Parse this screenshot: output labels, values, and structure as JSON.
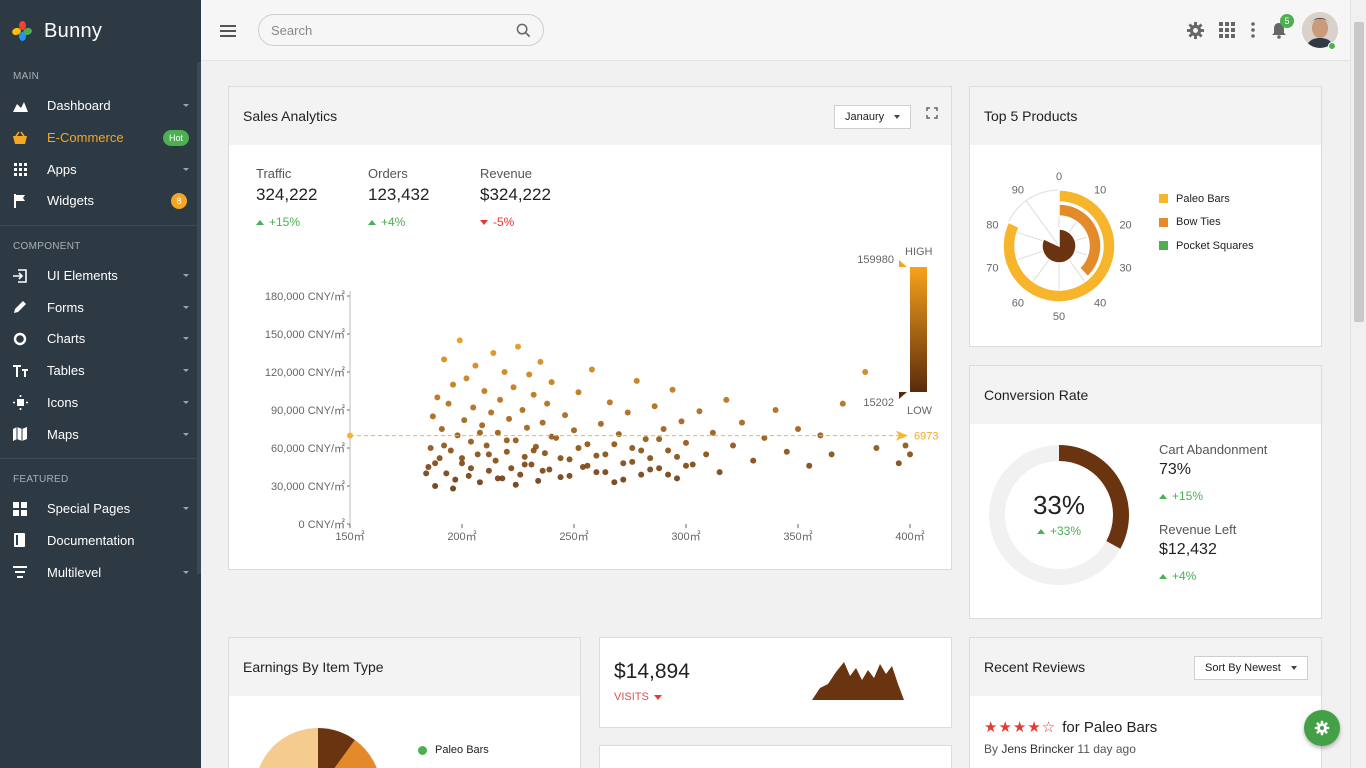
{
  "app": {
    "name": "Bunny"
  },
  "sidebar": {
    "sections": [
      {
        "label": "MAIN",
        "items": [
          {
            "label": "Dashboard",
            "icon": "area-chart-icon",
            "caret": true
          },
          {
            "label": "E-Commerce",
            "icon": "basket-icon",
            "badge": "Hot",
            "active": true
          },
          {
            "label": "Apps",
            "icon": "grid-icon",
            "caret": true
          },
          {
            "label": "Widgets",
            "icon": "flag-icon",
            "count": "8"
          }
        ]
      },
      {
        "label": "COMPONENT",
        "items": [
          {
            "label": "UI Elements",
            "icon": "login-icon",
            "caret": true
          },
          {
            "label": "Forms",
            "icon": "pencil-icon",
            "caret": true
          },
          {
            "label": "Charts",
            "icon": "donut-icon",
            "caret": true
          },
          {
            "label": "Tables",
            "icon": "text-height-icon",
            "caret": true
          },
          {
            "label": "Icons",
            "icon": "sun-icon",
            "caret": true
          },
          {
            "label": "Maps",
            "icon": "map-icon",
            "caret": true
          }
        ]
      },
      {
        "label": "FEATURED",
        "items": [
          {
            "label": "Special Pages",
            "icon": "pages-icon",
            "caret": true
          },
          {
            "label": "Documentation",
            "icon": "book-icon"
          },
          {
            "label": "Multilevel",
            "icon": "filter-icon",
            "caret": true
          }
        ]
      }
    ]
  },
  "topbar": {
    "search_placeholder": "Search",
    "notification_count": "5"
  },
  "sales": {
    "title": "Sales Analytics",
    "month": "Janaury",
    "stats": [
      {
        "label": "Traffic",
        "value": "324,222",
        "change": "+15%",
        "dir": "up"
      },
      {
        "label": "Orders",
        "value": "123,432",
        "change": "+4%",
        "dir": "up"
      },
      {
        "label": "Revenue",
        "value": "$324,222",
        "change": "-5%",
        "dir": "down"
      }
    ]
  },
  "top_products": {
    "title": "Top 5 Products",
    "legend": [
      {
        "name": "Paleo Bars",
        "color": "#f7b52c"
      },
      {
        "name": "Bow Ties",
        "color": "#e58a2a"
      },
      {
        "name": "Pocket Squares",
        "color": "#4caf50"
      }
    ],
    "ticks": [
      "0",
      "10",
      "20",
      "30",
      "40",
      "50",
      "60",
      "70",
      "80",
      "90"
    ]
  },
  "conversion": {
    "title": "Conversion Rate",
    "value": "33%",
    "change": "+33%",
    "percent": 33,
    "items": [
      {
        "label": "Cart Abandonment",
        "value": "73%",
        "change": "+15%"
      },
      {
        "label": "Revenue Left",
        "value": "$12,432",
        "change": "+4%"
      }
    ]
  },
  "earnings": {
    "title": "Earnings By Item Type",
    "legend": [
      "Paleo Bars"
    ]
  },
  "visits": {
    "value": "$14,894",
    "label": "VISITS"
  },
  "reviews": {
    "title": "Recent Reviews",
    "sort": "Sort By Newest",
    "items": [
      {
        "rating": 4,
        "product": "for Paleo Bars",
        "by": "By",
        "author": "Jens Brincker",
        "time": "11 day ago"
      }
    ]
  },
  "chart_data": {
    "type": "scatter",
    "title": "",
    "xlabel": "",
    "ylabel": "",
    "x_ticks": [
      "150㎡",
      "200㎡",
      "250㎡",
      "300㎡",
      "350㎡",
      "400㎡"
    ],
    "y_ticks": [
      "0 CNY/㎡",
      "30,000 CNY/㎡",
      "60,000 CNY/㎡",
      "90,000 CNY/㎡",
      "120,000 CNY/㎡",
      "150,000 CNY/㎡",
      "180,000 CNY/㎡"
    ],
    "xlim": [
      150,
      400
    ],
    "ylim": [
      0,
      180000
    ],
    "average_line": {
      "value": 69730,
      "label": "6973"
    },
    "visual_map": {
      "max": "159980",
      "min": "15202",
      "high_label": "HIGH",
      "low_label": "LOW",
      "colors": [
        "#f7a21b",
        "#5a2a0c"
      ]
    },
    "series": [
      {
        "points": [
          [
            185,
            45000
          ],
          [
            186,
            60000
          ],
          [
            187,
            85000
          ],
          [
            188,
            30000
          ],
          [
            189,
            100000
          ],
          [
            190,
            52000
          ],
          [
            191,
            75000
          ],
          [
            192,
            130000
          ],
          [
            193,
            40000
          ],
          [
            194,
            95000
          ],
          [
            195,
            58000
          ],
          [
            196,
            110000
          ],
          [
            197,
            35000
          ],
          [
            198,
            70000
          ],
          [
            199,
            145000
          ],
          [
            200,
            48000
          ],
          [
            201,
            82000
          ],
          [
            202,
            115000
          ],
          [
            203,
            38000
          ],
          [
            204,
            65000
          ],
          [
            205,
            92000
          ],
          [
            206,
            125000
          ],
          [
            207,
            55000
          ],
          [
            208,
            33000
          ],
          [
            209,
            78000
          ],
          [
            210,
            105000
          ],
          [
            211,
            62000
          ],
          [
            212,
            42000
          ],
          [
            213,
            88000
          ],
          [
            214,
            135000
          ],
          [
            215,
            50000
          ],
          [
            216,
            72000
          ],
          [
            217,
            98000
          ],
          [
            218,
            36000
          ],
          [
            219,
            120000
          ],
          [
            220,
            57000
          ],
          [
            221,
            83000
          ],
          [
            222,
            44000
          ],
          [
            223,
            108000
          ],
          [
            224,
            66000
          ],
          [
            225,
            140000
          ],
          [
            226,
            39000
          ],
          [
            227,
            90000
          ],
          [
            228,
            53000
          ],
          [
            229,
            76000
          ],
          [
            230,
            118000
          ],
          [
            231,
            47000
          ],
          [
            232,
            102000
          ],
          [
            233,
            61000
          ],
          [
            234,
            34000
          ],
          [
            235,
            128000
          ],
          [
            236,
            80000
          ],
          [
            237,
            56000
          ],
          [
            238,
            95000
          ],
          [
            239,
            43000
          ],
          [
            240,
            112000
          ],
          [
            242,
            68000
          ],
          [
            244,
            37000
          ],
          [
            246,
            86000
          ],
          [
            248,
            51000
          ],
          [
            250,
            74000
          ],
          [
            252,
            104000
          ],
          [
            254,
            45000
          ],
          [
            256,
            63000
          ],
          [
            258,
            122000
          ],
          [
            260,
            41000
          ],
          [
            262,
            79000
          ],
          [
            264,
            55000
          ],
          [
            266,
            96000
          ],
          [
            268,
            33000
          ],
          [
            270,
            71000
          ],
          [
            272,
            48000
          ],
          [
            274,
            88000
          ],
          [
            276,
            60000
          ],
          [
            278,
            113000
          ],
          [
            280,
            39000
          ],
          [
            282,
            67000
          ],
          [
            284,
            52000
          ],
          [
            286,
            93000
          ],
          [
            288,
            44000
          ],
          [
            290,
            75000
          ],
          [
            292,
            58000
          ],
          [
            294,
            106000
          ],
          [
            296,
            36000
          ],
          [
            298,
            81000
          ],
          [
            300,
            64000
          ],
          [
            303,
            47000
          ],
          [
            306,
            89000
          ],
          [
            309,
            55000
          ],
          [
            312,
            72000
          ],
          [
            315,
            41000
          ],
          [
            318,
            98000
          ],
          [
            321,
            62000
          ],
          [
            325,
            80000
          ],
          [
            330,
            50000
          ],
          [
            335,
            68000
          ],
          [
            340,
            90000
          ],
          [
            345,
            57000
          ],
          [
            350,
            75000
          ],
          [
            355,
            46000
          ],
          [
            360,
            70000
          ],
          [
            365,
            55000
          ],
          [
            370,
            95000
          ],
          [
            380,
            120000
          ],
          [
            385,
            60000
          ],
          [
            395,
            48000
          ],
          [
            398,
            62000
          ],
          [
            400,
            55000
          ],
          [
            184,
            40000
          ],
          [
            188,
            48000
          ],
          [
            192,
            62000
          ],
          [
            196,
            28000
          ],
          [
            200,
            52000
          ],
          [
            204,
            44000
          ],
          [
            208,
            72000
          ],
          [
            212,
            55000
          ],
          [
            216,
            36000
          ],
          [
            220,
            66000
          ],
          [
            224,
            31000
          ],
          [
            228,
            47000
          ],
          [
            232,
            58000
          ],
          [
            236,
            42000
          ],
          [
            240,
            69000
          ],
          [
            244,
            52000
          ],
          [
            248,
            38000
          ],
          [
            252,
            60000
          ],
          [
            256,
            46000
          ],
          [
            260,
            54000
          ],
          [
            264,
            41000
          ],
          [
            268,
            63000
          ],
          [
            272,
            35000
          ],
          [
            276,
            49000
          ],
          [
            280,
            58000
          ],
          [
            284,
            43000
          ],
          [
            288,
            67000
          ],
          [
            292,
            39000
          ],
          [
            296,
            53000
          ],
          [
            300,
            46000
          ]
        ]
      }
    ]
  }
}
